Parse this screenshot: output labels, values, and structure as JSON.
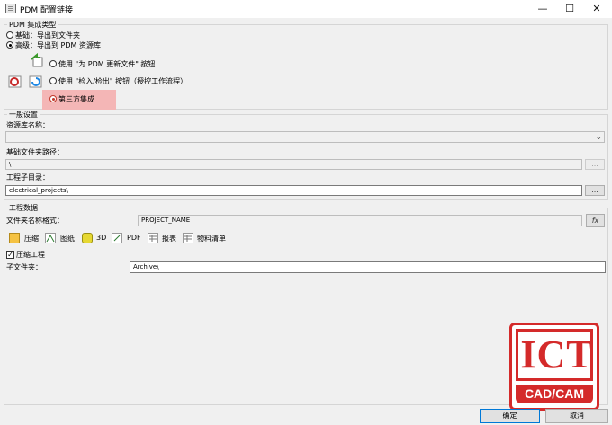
{
  "window": {
    "title": "PDM 配置链接",
    "minimize": "—",
    "maximize": "☐",
    "close": "✕"
  },
  "integration": {
    "group_title": "PDM 集成类型",
    "basic_label": "基础：导出到文件夹",
    "advanced_label": "高级：导出到 PDM 资源库",
    "opt_update_label": "使用 \"为 PDM 更新文件\" 按钮",
    "opt_checkin_label": "使用 \"检入/检出\" 按钮（授控工作流程）",
    "opt_third_party_label": "第三方集成",
    "selected": "third_party"
  },
  "general": {
    "group_title": "一般设置",
    "vault_label": "资源库名称：",
    "vault_value": "",
    "base_folder_label": "基础文件夹路径：",
    "base_folder_value": "\\",
    "project_subdir_label": "工程子目录：",
    "project_subdir_value": "electrical_projects\\",
    "browse_label": "..."
  },
  "project_data": {
    "group_title": "工程数据",
    "filename_format_label": "文件夹名称格式：",
    "filename_format_value": "PROJECT_NAME",
    "fx_label": "fx",
    "tabs": [
      "压缩",
      "图纸",
      "3D",
      "PDF",
      "报表",
      "物料清单"
    ],
    "compress_checked": true,
    "compress_label": "压缩工程",
    "subfolder_label": "子文件夹：",
    "subfolder_value": "Archive\\"
  },
  "buttons": {
    "ok": "确定",
    "cancel": "取消"
  },
  "watermark": {
    "logo_text": "ICT",
    "logo_sub": "CAD/CAM"
  },
  "colors": {
    "highlight": "#f4b6b6",
    "watermark_red": "#d42a2a",
    "default_button_border": "#0078d7"
  }
}
